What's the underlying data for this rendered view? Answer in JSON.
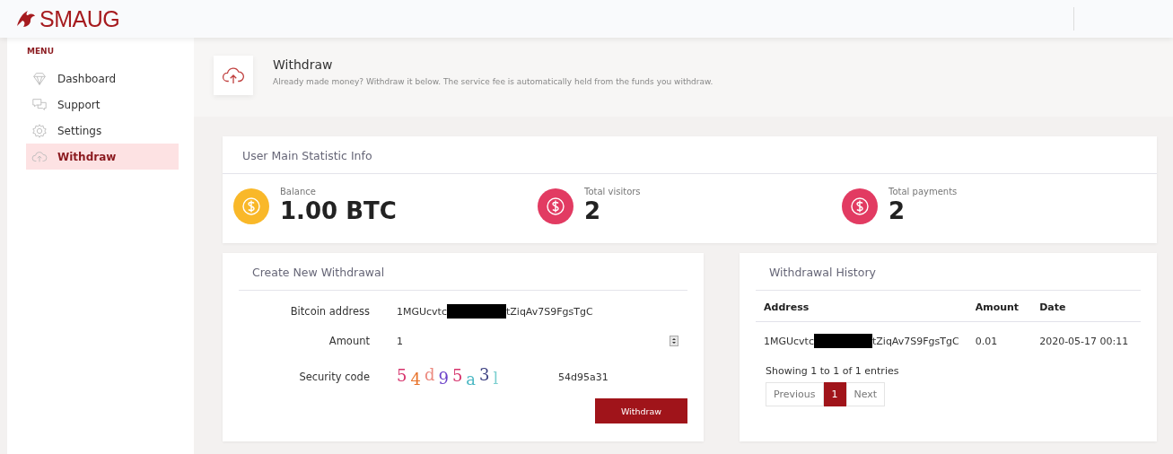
{
  "brand": "SMAUG",
  "sidebar": {
    "heading": "MENU",
    "items": [
      {
        "label": "Dashboard",
        "kind": "diamond",
        "selected": false
      },
      {
        "label": "Support",
        "kind": "chat",
        "selected": false
      },
      {
        "label": "Settings",
        "kind": "gear",
        "selected": false
      },
      {
        "label": "Withdraw",
        "kind": "cloud",
        "selected": true
      }
    ]
  },
  "page_header": {
    "title": "Withdraw",
    "subtitle": "Already made money? Withdraw it below. The service fee is automatically held from the funds you withdraw."
  },
  "stats": {
    "title": "User Main Statistic Info",
    "items": [
      {
        "label": "Balance",
        "value": "1.00 BTC",
        "color": "#f9b829"
      },
      {
        "label": "Total visitors",
        "value": "2",
        "color": "#e23b62"
      },
      {
        "label": "Total payments",
        "value": "2",
        "color": "#e23b62"
      }
    ]
  },
  "withdraw_form": {
    "title": "Create New Withdrawal",
    "address_label": "Bitcoin address",
    "address_start": "1MGUcvtc",
    "address_end": "tZiqAv7S9FgsTgC",
    "amount_label": "Amount",
    "amount_value": "1",
    "code_label": "Security code",
    "captcha": [
      {
        "char": "5",
        "color": "#d6336c"
      },
      {
        "char": "4",
        "color": "#e8742c"
      },
      {
        "char": "d",
        "color": "#ec8a80"
      },
      {
        "char": "9",
        "color": "#6a3fc8"
      },
      {
        "char": "5",
        "color": "#d6336c"
      },
      {
        "char": "a",
        "color": "#4cb8c4"
      },
      {
        "char": "3",
        "color": "#3b3f80"
      },
      {
        "char": "l",
        "color": "#7ccfd0"
      }
    ],
    "code_value": "54d95a31",
    "button": "Withdraw"
  },
  "history": {
    "title": "Withdrawal History",
    "columns": [
      "Address",
      "Amount",
      "Date"
    ],
    "rows": [
      {
        "address_start": "1MGUcvtc",
        "address_end": "tZiqAv7S9FgsTgC",
        "amount": "0.01",
        "date": "2020-05-17 00:11"
      }
    ],
    "info": "Showing 1 to 1 of 1 entries",
    "pages": [
      {
        "label": "Previous",
        "selected": false
      },
      {
        "label": "1",
        "selected": true
      },
      {
        "label": "Next",
        "selected": false
      }
    ]
  }
}
